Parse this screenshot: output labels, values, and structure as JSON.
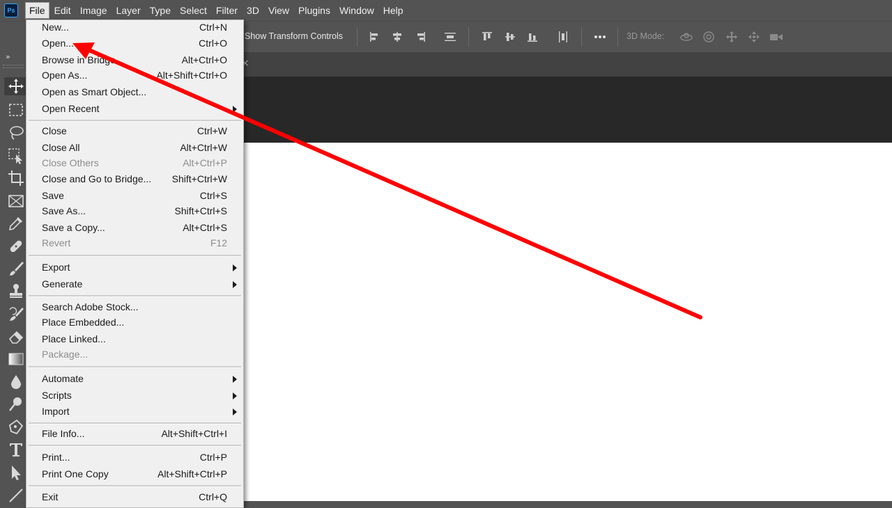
{
  "app": {
    "logo_text": "Ps"
  },
  "menubar": {
    "items": [
      {
        "label": "File",
        "name": "menu-file",
        "active": true
      },
      {
        "label": "Edit",
        "name": "menu-edit"
      },
      {
        "label": "Image",
        "name": "menu-image"
      },
      {
        "label": "Layer",
        "name": "menu-layer"
      },
      {
        "label": "Type",
        "name": "menu-type"
      },
      {
        "label": "Select",
        "name": "menu-select"
      },
      {
        "label": "Filter",
        "name": "menu-filter"
      },
      {
        "label": "3D",
        "name": "menu-3d"
      },
      {
        "label": "View",
        "name": "menu-view"
      },
      {
        "label": "Plugins",
        "name": "menu-plugins"
      },
      {
        "label": "Window",
        "name": "menu-window"
      },
      {
        "label": "Help",
        "name": "menu-help"
      }
    ]
  },
  "options_bar": {
    "show_transform_controls": "Show Transform Controls",
    "mode_3d_label": "3D Mode:",
    "more_icon": "ellipsis-icon"
  },
  "toolbar": {
    "collapse_glyph": "»",
    "tools": [
      {
        "name": "move-tool-icon",
        "selected": true
      },
      {
        "name": "marquee-tool-icon"
      },
      {
        "name": "lasso-tool-icon"
      },
      {
        "name": "object-selection-tool-icon"
      },
      {
        "name": "crop-tool-icon"
      },
      {
        "name": "frame-tool-icon"
      },
      {
        "name": "eyedropper-tool-icon"
      },
      {
        "name": "healing-brush-tool-icon"
      },
      {
        "name": "brush-tool-icon"
      },
      {
        "name": "clone-stamp-tool-icon"
      },
      {
        "name": "history-brush-tool-icon"
      },
      {
        "name": "eraser-tool-icon"
      },
      {
        "name": "gradient-tool-icon"
      },
      {
        "name": "blur-tool-icon"
      },
      {
        "name": "dodge-tool-icon"
      },
      {
        "name": "pen-tool-icon"
      },
      {
        "name": "type-tool-icon"
      },
      {
        "name": "path-selection-tool-icon"
      },
      {
        "name": "line-tool-icon"
      }
    ]
  },
  "tab": {
    "close_glyph": "×"
  },
  "file_menu": {
    "items": [
      {
        "label": "New...",
        "shortcut": "Ctrl+N"
      },
      {
        "label": "Open...",
        "shortcut": "Ctrl+O"
      },
      {
        "label": "Browse in Bridge...",
        "shortcut": "Alt+Ctrl+O"
      },
      {
        "label": "Open As...",
        "shortcut": "Alt+Shift+Ctrl+O"
      },
      {
        "label": "Open as Smart Object...",
        "shortcut": ""
      },
      {
        "label": "Open Recent",
        "shortcut": "",
        "submenu": true
      },
      {
        "label": "Close",
        "shortcut": "Ctrl+W"
      },
      {
        "label": "Close All",
        "shortcut": "Alt+Ctrl+W"
      },
      {
        "label": "Close Others",
        "shortcut": "Alt+Ctrl+P",
        "disabled": true
      },
      {
        "label": "Close and Go to Bridge...",
        "shortcut": "Shift+Ctrl+W"
      },
      {
        "label": "Save",
        "shortcut": "Ctrl+S"
      },
      {
        "label": "Save As...",
        "shortcut": "Shift+Ctrl+S"
      },
      {
        "label": "Save a Copy...",
        "shortcut": "Alt+Ctrl+S"
      },
      {
        "label": "Revert",
        "shortcut": "F12",
        "disabled": true
      },
      {
        "label": "Export",
        "shortcut": "",
        "submenu": true
      },
      {
        "label": "Generate",
        "shortcut": "",
        "submenu": true
      },
      {
        "label": "Search Adobe Stock...",
        "shortcut": ""
      },
      {
        "label": "Place Embedded...",
        "shortcut": ""
      },
      {
        "label": "Place Linked...",
        "shortcut": ""
      },
      {
        "label": "Package...",
        "shortcut": "",
        "disabled": true
      },
      {
        "label": "Automate",
        "shortcut": "",
        "submenu": true
      },
      {
        "label": "Scripts",
        "shortcut": "",
        "submenu": true
      },
      {
        "label": "Import",
        "shortcut": "",
        "submenu": true
      },
      {
        "label": "File Info...",
        "shortcut": "Alt+Shift+Ctrl+I"
      },
      {
        "label": "Print...",
        "shortcut": "Ctrl+P"
      },
      {
        "label": "Print One Copy",
        "shortcut": "Alt+Shift+Ctrl+P"
      },
      {
        "label": "Exit",
        "shortcut": "Ctrl+Q"
      }
    ]
  },
  "annotation": {
    "color": "#ff0000"
  }
}
